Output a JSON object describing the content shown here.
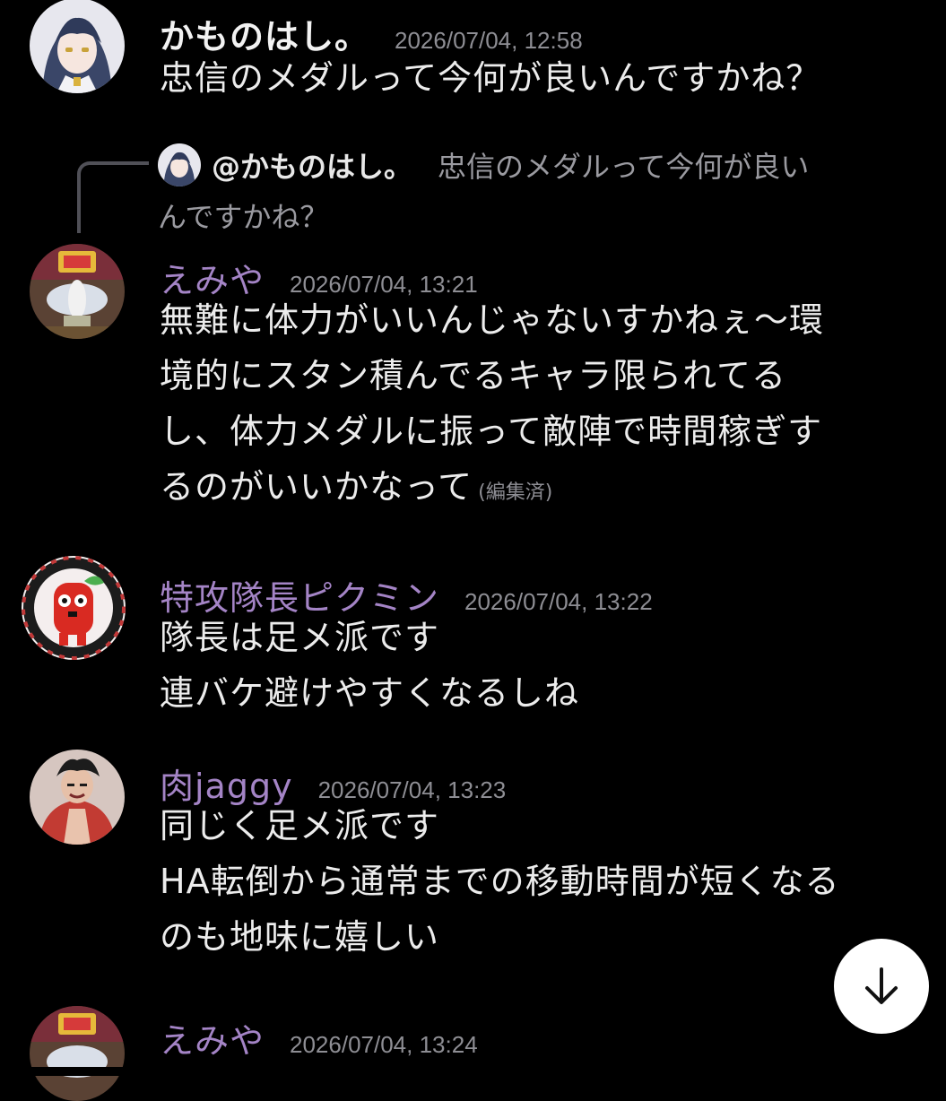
{
  "colors": {
    "background": "#000000",
    "author_purple": "#a484c6",
    "timestamp_gray": "#8e8e94",
    "message_text": "#ececec"
  },
  "messages": [
    {
      "author": "かものはし。",
      "timestamp": "2026/07/04, 12:58",
      "lines": [
        "忠信のメダルって今何が良いんですかね？"
      ],
      "avatar_icon": "anime-girl-avatar"
    },
    {
      "reply": {
        "author": "@かものはし。",
        "text_line1": "忠信のメダルって今何が良い",
        "text_line2": "んですかね？"
      },
      "author": "えみや",
      "timestamp": "2026/07/04, 13:21",
      "lines": [
        "無難に体力がいいんじゃないすかねぇ～環",
        "境的にスタン積んでるキャラ限られてる",
        "し、体力メダルに振って敵陣で時間稼ぎす",
        "るのがいいかなって"
      ],
      "edited_label": "(編集済)",
      "avatar_icon": "game-character-avatar"
    },
    {
      "author": "特攻隊長ピクミン",
      "timestamp": "2026/07/04, 13:22",
      "lines": [
        "隊長は足メ派です",
        "連バケ避けやすくなるしね"
      ],
      "avatar_icon": "red-pikmin-avatar"
    },
    {
      "author": "肉jaggy",
      "timestamp": "2026/07/04, 13:23",
      "lines": [
        "同じく足メ派です",
        "HA転倒から通常までの移動時間が短くなる",
        "のも地味に嬉しい"
      ],
      "avatar_icon": "muscle-character-avatar"
    },
    {
      "author": "えみや",
      "timestamp": "2026/07/04, 13:24",
      "avatar_icon": "game-character-avatar"
    }
  ],
  "scroll_button": {
    "icon": "arrow-down-icon"
  }
}
